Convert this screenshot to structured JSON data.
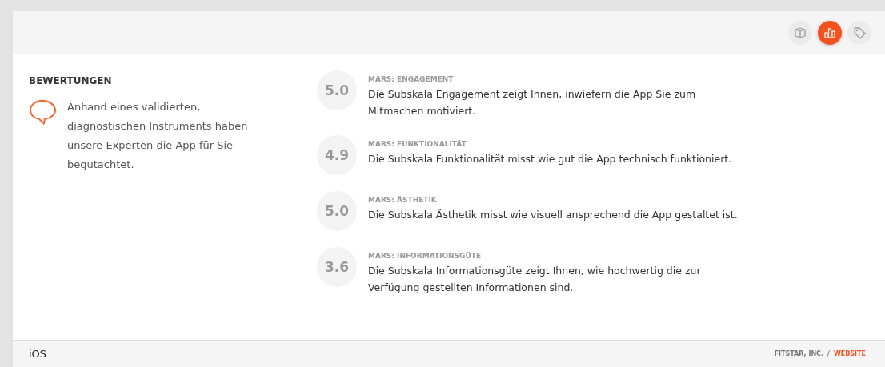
{
  "header_tabs": [
    {
      "kind": "box",
      "selected": false
    },
    {
      "kind": "chart",
      "selected": true
    },
    {
      "kind": "tag",
      "selected": false
    }
  ],
  "section": {
    "title": "BEWERTUNGEN",
    "intro": "Anhand eines validierten, diagnostischen Instruments haben unsere Experten die App für Sie begutachtet."
  },
  "ratings": [
    {
      "score": "5.0",
      "label": "MARS: ENGAGEMENT",
      "description": "Die Subskala Engagement zeigt Ihnen, inwiefern die App Sie zum Mitmachen motiviert."
    },
    {
      "score": "4.9",
      "label": "MARS: FUNKTIONALITÄT",
      "description": "Die Subskala Funktionalität misst wie gut die App technisch funktioniert."
    },
    {
      "score": "5.0",
      "label": "MARS: ÄSTHETIK",
      "description": "Die Subskala Ästhetik misst wie visuell ansprechend die App gestaltet ist."
    },
    {
      "score": "3.6",
      "label": "MARS: INFORMATIONSGÜTE",
      "description": "Die Subskala Informationsgüte zeigt Ihnen, wie hochwertig die zur Verfügung gestellten Informationen sind."
    }
  ],
  "footer": {
    "platform": "iOS",
    "developer": "FITSTAR, INC.",
    "separator": "/",
    "link": "WEBSITE"
  }
}
